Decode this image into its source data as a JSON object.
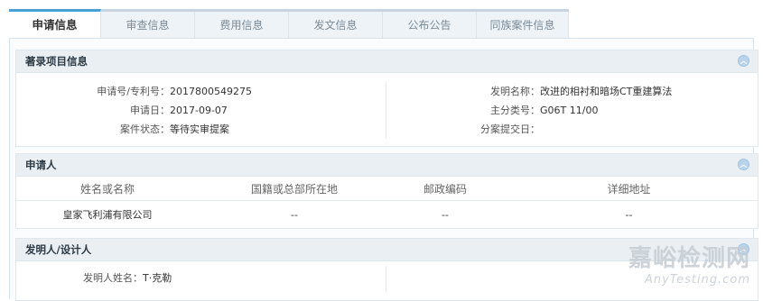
{
  "tabs": [
    {
      "label": "申请信息",
      "active": true
    },
    {
      "label": "审查信息",
      "active": false
    },
    {
      "label": "费用信息",
      "active": false
    },
    {
      "label": "发文信息",
      "active": false
    },
    {
      "label": "公布公告",
      "active": false
    },
    {
      "label": "同族案件信息",
      "active": false
    }
  ],
  "biblio": {
    "title": "著录项目信息",
    "app_no_label": "申请号/专利号：",
    "app_no": "2017800549275",
    "app_date_label": "申请日：",
    "app_date": "2017-09-07",
    "status_label": "案件状态：",
    "status": "等待实审提案",
    "invention_label": "发明名称：",
    "invention": "改进的相衬和暗场CT重建算法",
    "class_label": "主分类号：",
    "class": "G06T 11/00",
    "divisional_label": "分案提交日："
  },
  "applicant": {
    "title": "申请人",
    "headers": [
      "姓名或名称",
      "国籍或总部所在地",
      "邮政编码",
      "详细地址"
    ],
    "rows": [
      [
        "皇家飞利浦有限公司",
        "--",
        "--",
        "--"
      ]
    ]
  },
  "inventor": {
    "title": "发明人/设计人",
    "name_label": "发明人姓名：",
    "name": "T·克勒"
  },
  "watermark": {
    "cn": "嘉峪检测网",
    "en": "AnyTesting.com"
  },
  "colors": {
    "accent": "#4a9fd8",
    "header_bg": "#eaeff3"
  }
}
